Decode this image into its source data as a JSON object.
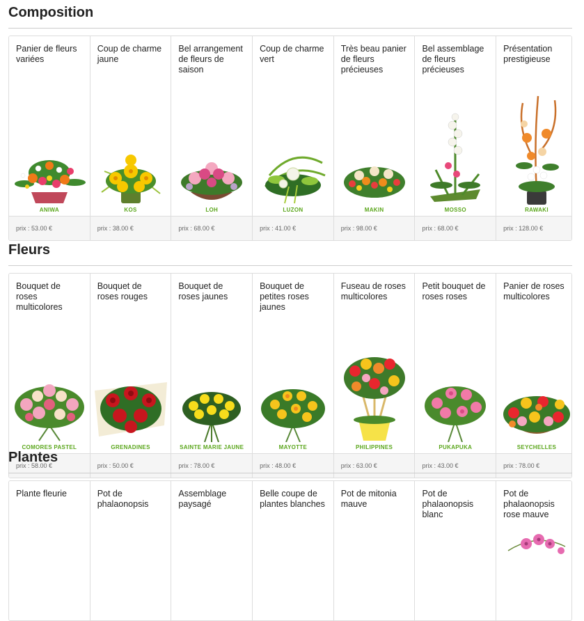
{
  "sections": [
    {
      "title": "Composition",
      "items": [
        {
          "title": "Panier de fleurs variées",
          "name": "ANIWA",
          "price": "prix : 53.00 €",
          "icon": "mixed-flower-basket-icon"
        },
        {
          "title": "Coup de charme jaune",
          "name": "KOS",
          "price": "prix : 38.00 €",
          "icon": "yellow-bouquet-icon"
        },
        {
          "title": "Bel arrangement de fleurs de saison",
          "name": "LOH",
          "price": "prix : 68.00 €",
          "icon": "pink-arrangement-icon"
        },
        {
          "title": "Coup de charme vert",
          "name": "LUZON",
          "price": "prix : 41.00 €",
          "icon": "green-arrangement-icon"
        },
        {
          "title": "Très beau panier de fleurs précieuses",
          "name": "MAKIN",
          "price": "prix : 98.00 €",
          "icon": "colorful-basket-icon"
        },
        {
          "title": "Bel assemblage de fleurs précieuses",
          "name": "MOSSO",
          "price": "prix : 68.00 €",
          "icon": "tall-white-arrangement-icon"
        },
        {
          "title": "Présentation prestigieuse",
          "name": "RAWAKI",
          "price": "prix : 128.00 €",
          "icon": "tall-orange-arrangement-icon"
        }
      ]
    },
    {
      "title": "Fleurs",
      "items": [
        {
          "title": "Bouquet de roses multicolores",
          "name": "COMORES PASTEL",
          "price": "prix : 58.00 €",
          "icon": "pastel-roses-icon"
        },
        {
          "title": "Bouquet de roses rouges",
          "name": "GRENADINES",
          "price": "prix : 50.00 €",
          "icon": "red-roses-icon"
        },
        {
          "title": "Bouquet de roses jaunes",
          "name": "SAINTE MARIE JAUNE",
          "price": "prix : 78.00 €",
          "icon": "yellow-roses-icon"
        },
        {
          "title": "Bouquet de petites roses jaunes",
          "name": "MAYOTTE",
          "price": "prix : 48.00 €",
          "icon": "small-yellow-roses-icon"
        },
        {
          "title": "Fuseau de roses multicolores",
          "name": "PHILIPPINES",
          "price": "prix : 63.00 €",
          "icon": "roses-in-pot-icon"
        },
        {
          "title": "Petit bouquet de roses roses",
          "name": "PUKAPUKA",
          "price": "prix : 43.00 €",
          "icon": "pink-roses-icon"
        },
        {
          "title": "Panier de roses multicolores",
          "name": "SEYCHELLES",
          "price": "prix : 78.00 €",
          "icon": "roses-basket-icon"
        }
      ]
    },
    {
      "title": "Plantes",
      "items": [
        {
          "title": "Plante fleurie",
          "name": "",
          "price": "",
          "icon": ""
        },
        {
          "title": "Pot de phalaonopsis",
          "name": "",
          "price": "",
          "icon": ""
        },
        {
          "title": "Assemblage paysagé",
          "name": "",
          "price": "",
          "icon": ""
        },
        {
          "title": "Belle coupe de plantes blanches",
          "name": "",
          "price": "",
          "icon": ""
        },
        {
          "title": "Pot de mitonia mauve",
          "name": "",
          "price": "",
          "icon": ""
        },
        {
          "title": "Pot de phalaonopsis blanc",
          "name": "",
          "price": "",
          "icon": ""
        },
        {
          "title": "Pot de phalaonopsis rose mauve",
          "name": "",
          "price": "",
          "icon": "orchid-icon"
        }
      ]
    }
  ],
  "colors": {
    "accent_green": "#5aa61b",
    "footer_bg": "#f5f5f5",
    "border": "#dddddd"
  }
}
